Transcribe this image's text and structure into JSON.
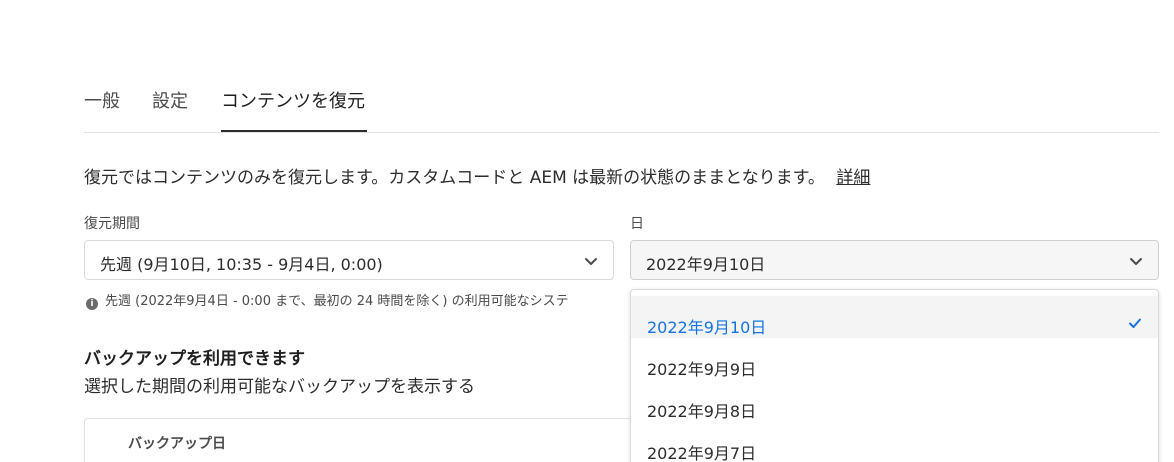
{
  "tabs": [
    {
      "label": "一般"
    },
    {
      "label": "設定"
    },
    {
      "label": "コンテンツを復元",
      "active": true
    }
  ],
  "description": {
    "text": "復元ではコンテンツのみを復元します。カスタムコードと AEM は最新の状態のままとなります。",
    "link": "詳細"
  },
  "restore_period": {
    "label": "復元期間",
    "value": "先週 (9月10日, 10:35 - 9月4日, 0:00)"
  },
  "day": {
    "label": "日",
    "value": "2022年9月10日"
  },
  "info_text": "先週 (2022年9月4日 - 0:00 まで、最初の 24 時間を除く) の利用可能なシステ",
  "backups": {
    "title": "バックアップを利用できます",
    "subtitle": "選択した期間の利用可能なバックアップを表示する",
    "column_header": "バックアップ日"
  },
  "dropdown": {
    "options": [
      "2022年9月10日",
      "2022年9月9日",
      "2022年9月8日",
      "2022年9月7日"
    ],
    "selected_index": 0
  },
  "colors": {
    "accent": "#1473e6",
    "text": "#2c2c2c"
  }
}
